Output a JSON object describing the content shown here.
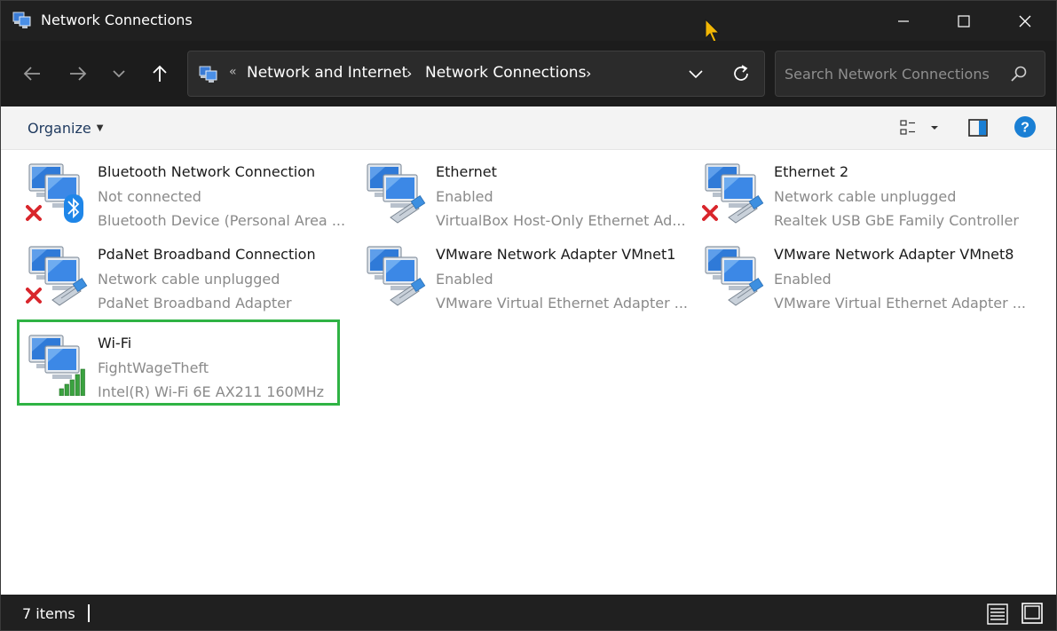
{
  "window": {
    "title": "Network Connections"
  },
  "address": {
    "crumbs": [
      "Network and Internet",
      "Network Connections"
    ]
  },
  "search": {
    "placeholder": "Search Network Connections"
  },
  "toolbar": {
    "organize_label": "Organize"
  },
  "items": [
    {
      "name": "Bluetooth Network Connection",
      "status": "Not connected",
      "device": "Bluetooth Device (Personal Area ...",
      "overlay": "bluetooth",
      "disabled": true
    },
    {
      "name": "Ethernet",
      "status": "Enabled",
      "device": "VirtualBox Host-Only Ethernet Ad...",
      "overlay": "cable",
      "disabled": false
    },
    {
      "name": "Ethernet 2",
      "status": "Network cable unplugged",
      "device": "Realtek USB GbE Family Controller",
      "overlay": "cable",
      "disabled": true
    },
    {
      "name": "PdaNet Broadband Connection",
      "status": "Network cable unplugged",
      "device": "PdaNet Broadband Adapter",
      "overlay": "cable",
      "disabled": true
    },
    {
      "name": "VMware Network Adapter VMnet1",
      "status": "Enabled",
      "device": "VMware Virtual Ethernet Adapter ...",
      "overlay": "cable",
      "disabled": false
    },
    {
      "name": "VMware Network Adapter VMnet8",
      "status": "Enabled",
      "device": "VMware Virtual Ethernet Adapter ...",
      "overlay": "cable",
      "disabled": false
    },
    {
      "name": "Wi-Fi",
      "status": "FightWageTheft",
      "device": "Intel(R) Wi-Fi 6E AX211 160MHz",
      "overlay": "signal",
      "disabled": false
    }
  ],
  "statusbar": {
    "count": "7 items"
  },
  "colors": {
    "titlebar": "#202020",
    "selection_border": "#2fb344",
    "help_blue": "#1a7fd4",
    "bluetooth_blue": "#1f86e8",
    "error_red": "#d9262c"
  }
}
